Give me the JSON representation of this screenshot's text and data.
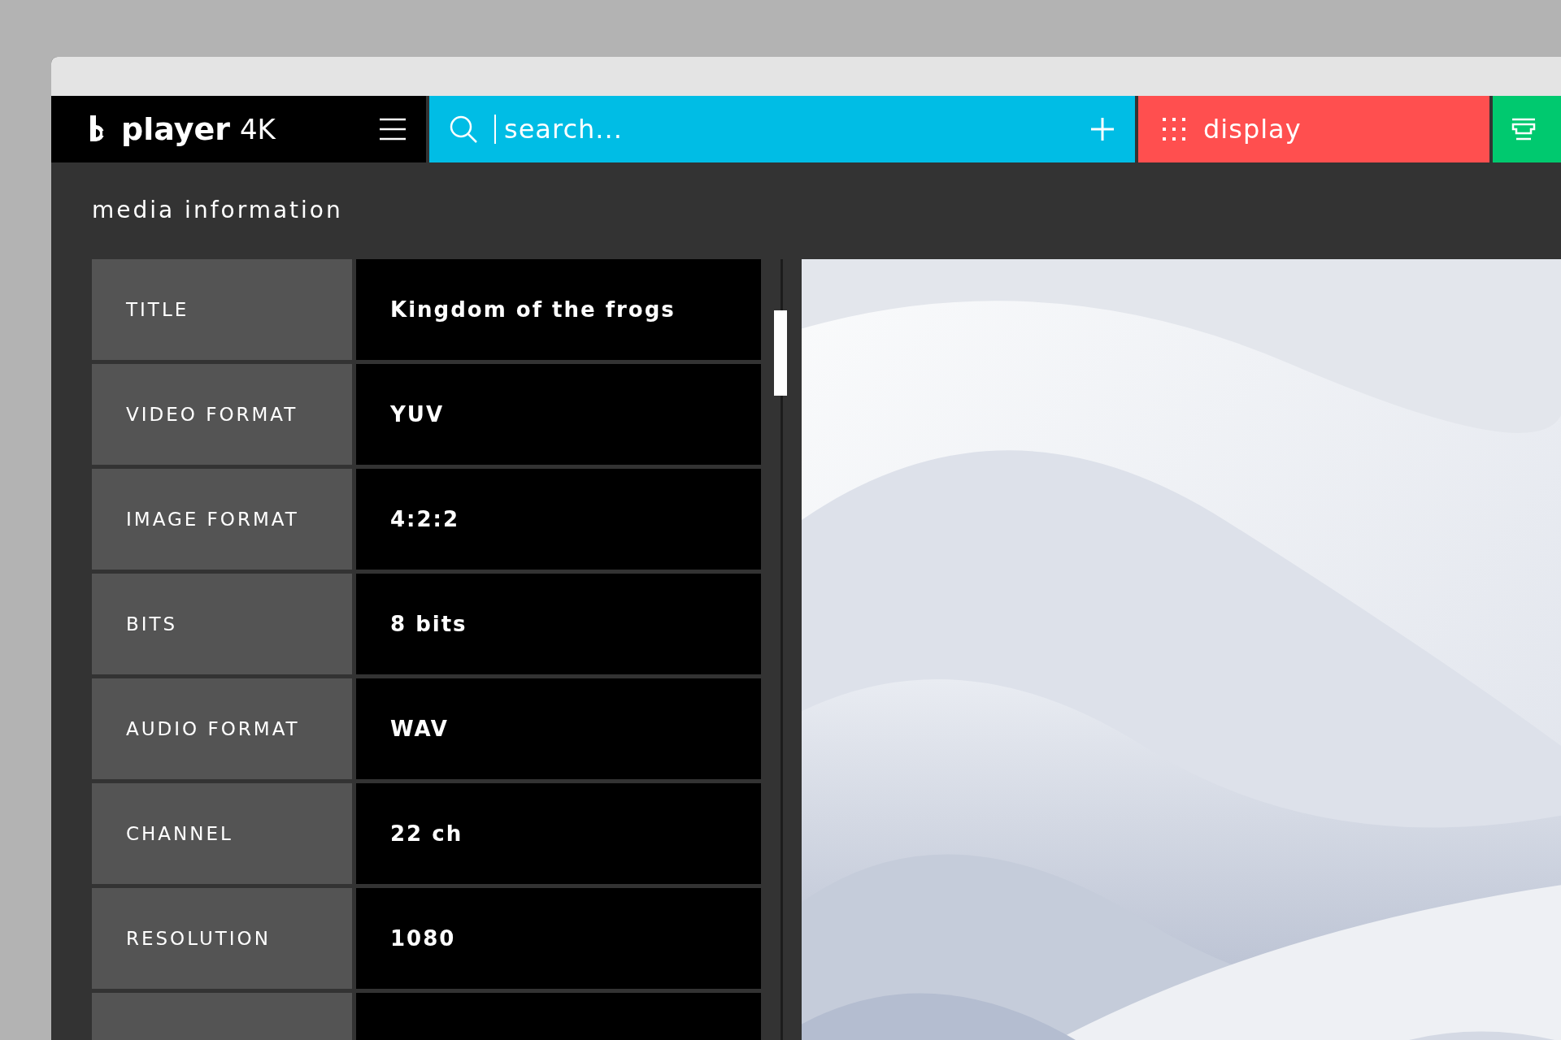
{
  "header": {
    "logo_text": "player",
    "logo_suffix": "4K",
    "search": {
      "placeholder": "search..."
    },
    "display_tab": {
      "label": "display"
    }
  },
  "panel": {
    "title": "media information"
  },
  "rows": [
    {
      "label": "TITLE",
      "value": "Kingdom of the frogs"
    },
    {
      "label": "VIDEO FORMAT",
      "value": "YUV"
    },
    {
      "label": "IMAGE FORMAT",
      "value": "4:2:2"
    },
    {
      "label": "BITS",
      "value": "8 bits"
    },
    {
      "label": "AUDIO FORMAT",
      "value": "WAV"
    },
    {
      "label": "CHANNEL",
      "value": "22 ch"
    },
    {
      "label": "RESOLUTION",
      "value": "1080"
    },
    {
      "label": "",
      "value": ""
    }
  ]
}
